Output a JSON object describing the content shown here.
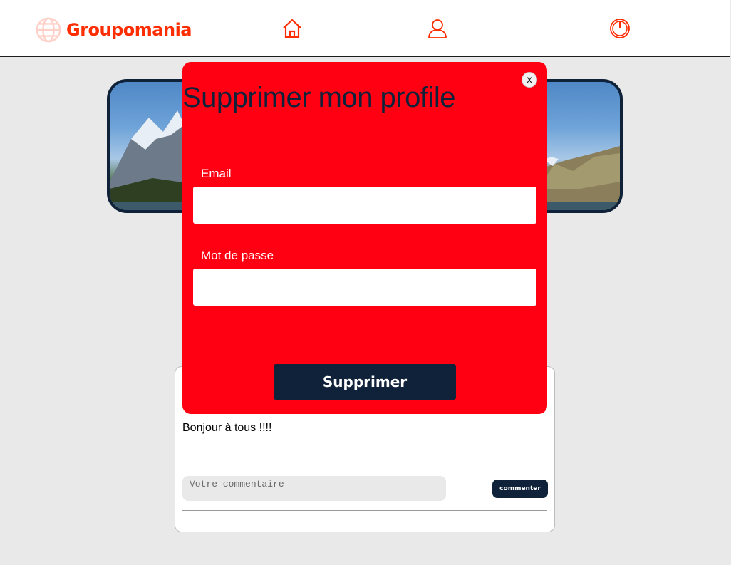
{
  "header": {
    "brand": "Groupomania",
    "nav": [
      {
        "icon": "home-icon"
      },
      {
        "icon": "user-icon"
      },
      {
        "icon": "power-icon"
      }
    ]
  },
  "post": {
    "text": "Bonjour à tous !!!!",
    "comment_placeholder": "Votre commentaire",
    "comment_button": "commenter"
  },
  "modal": {
    "close_label": "x",
    "title": "Supprimer mon profile",
    "email_label": "Email",
    "email_value": "",
    "password_label": "Mot de passe",
    "password_value": "",
    "submit_label": "Supprimer"
  },
  "colors": {
    "brand": "#fd2d01",
    "modal_bg": "#ff0012",
    "dark_navy": "#10223a",
    "page_bg": "#e9e9e9"
  }
}
